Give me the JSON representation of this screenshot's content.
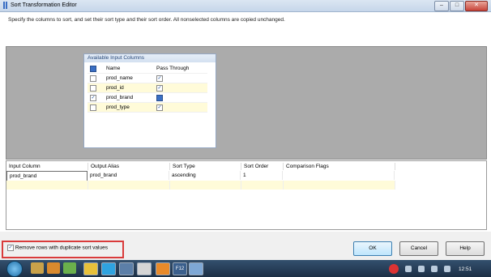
{
  "window": {
    "title": "Sort Transformation Editor",
    "minimize": "–",
    "maximize": "□",
    "close": "✕",
    "icon": "ssis-transform-icon"
  },
  "description": "Specify the columns to sort, and set their sort type and their sort order. All nonselected columns are copied unchanged.",
  "available_columns": {
    "title": "Available Input Columns",
    "headers": [
      "Name",
      "Pass Through"
    ],
    "rows": [
      {
        "name": "prod_name",
        "selected": false,
        "pass_through": true
      },
      {
        "name": "prod_id",
        "selected": false,
        "pass_through": true
      },
      {
        "name": "prod_brand",
        "selected": true,
        "pass_through": "indeterminate"
      },
      {
        "name": "prod_type",
        "selected": false,
        "pass_through": true
      }
    ]
  },
  "sort_grid": {
    "headers": [
      "Input Column",
      "Output Alias",
      "Sort Type",
      "Sort Order",
      "Comparison Flags"
    ],
    "rows": [
      [
        "prod_brand",
        "prod_brand",
        "ascending",
        "1",
        ""
      ]
    ]
  },
  "options": {
    "remove_duplicates_label": "Remove rows with duplicate sort values",
    "remove_duplicates_checked": true
  },
  "buttons": {
    "ok": "OK",
    "cancel": "Cancel",
    "help": "Help"
  },
  "taskbar": {
    "clock": "12:51",
    "items": [
      "start-orb",
      "windows-explorer-icon",
      "media-player-icon",
      "firefox-icon",
      "chrome-icon",
      "skype-icon",
      "ssis-icon",
      "notepad-icon",
      "visual-studio-icon",
      "f12-icon",
      "window-icon"
    ]
  },
  "colors": {
    "highlight_box": "#d93b3b",
    "grid_row_tint": "#fffbd9"
  }
}
